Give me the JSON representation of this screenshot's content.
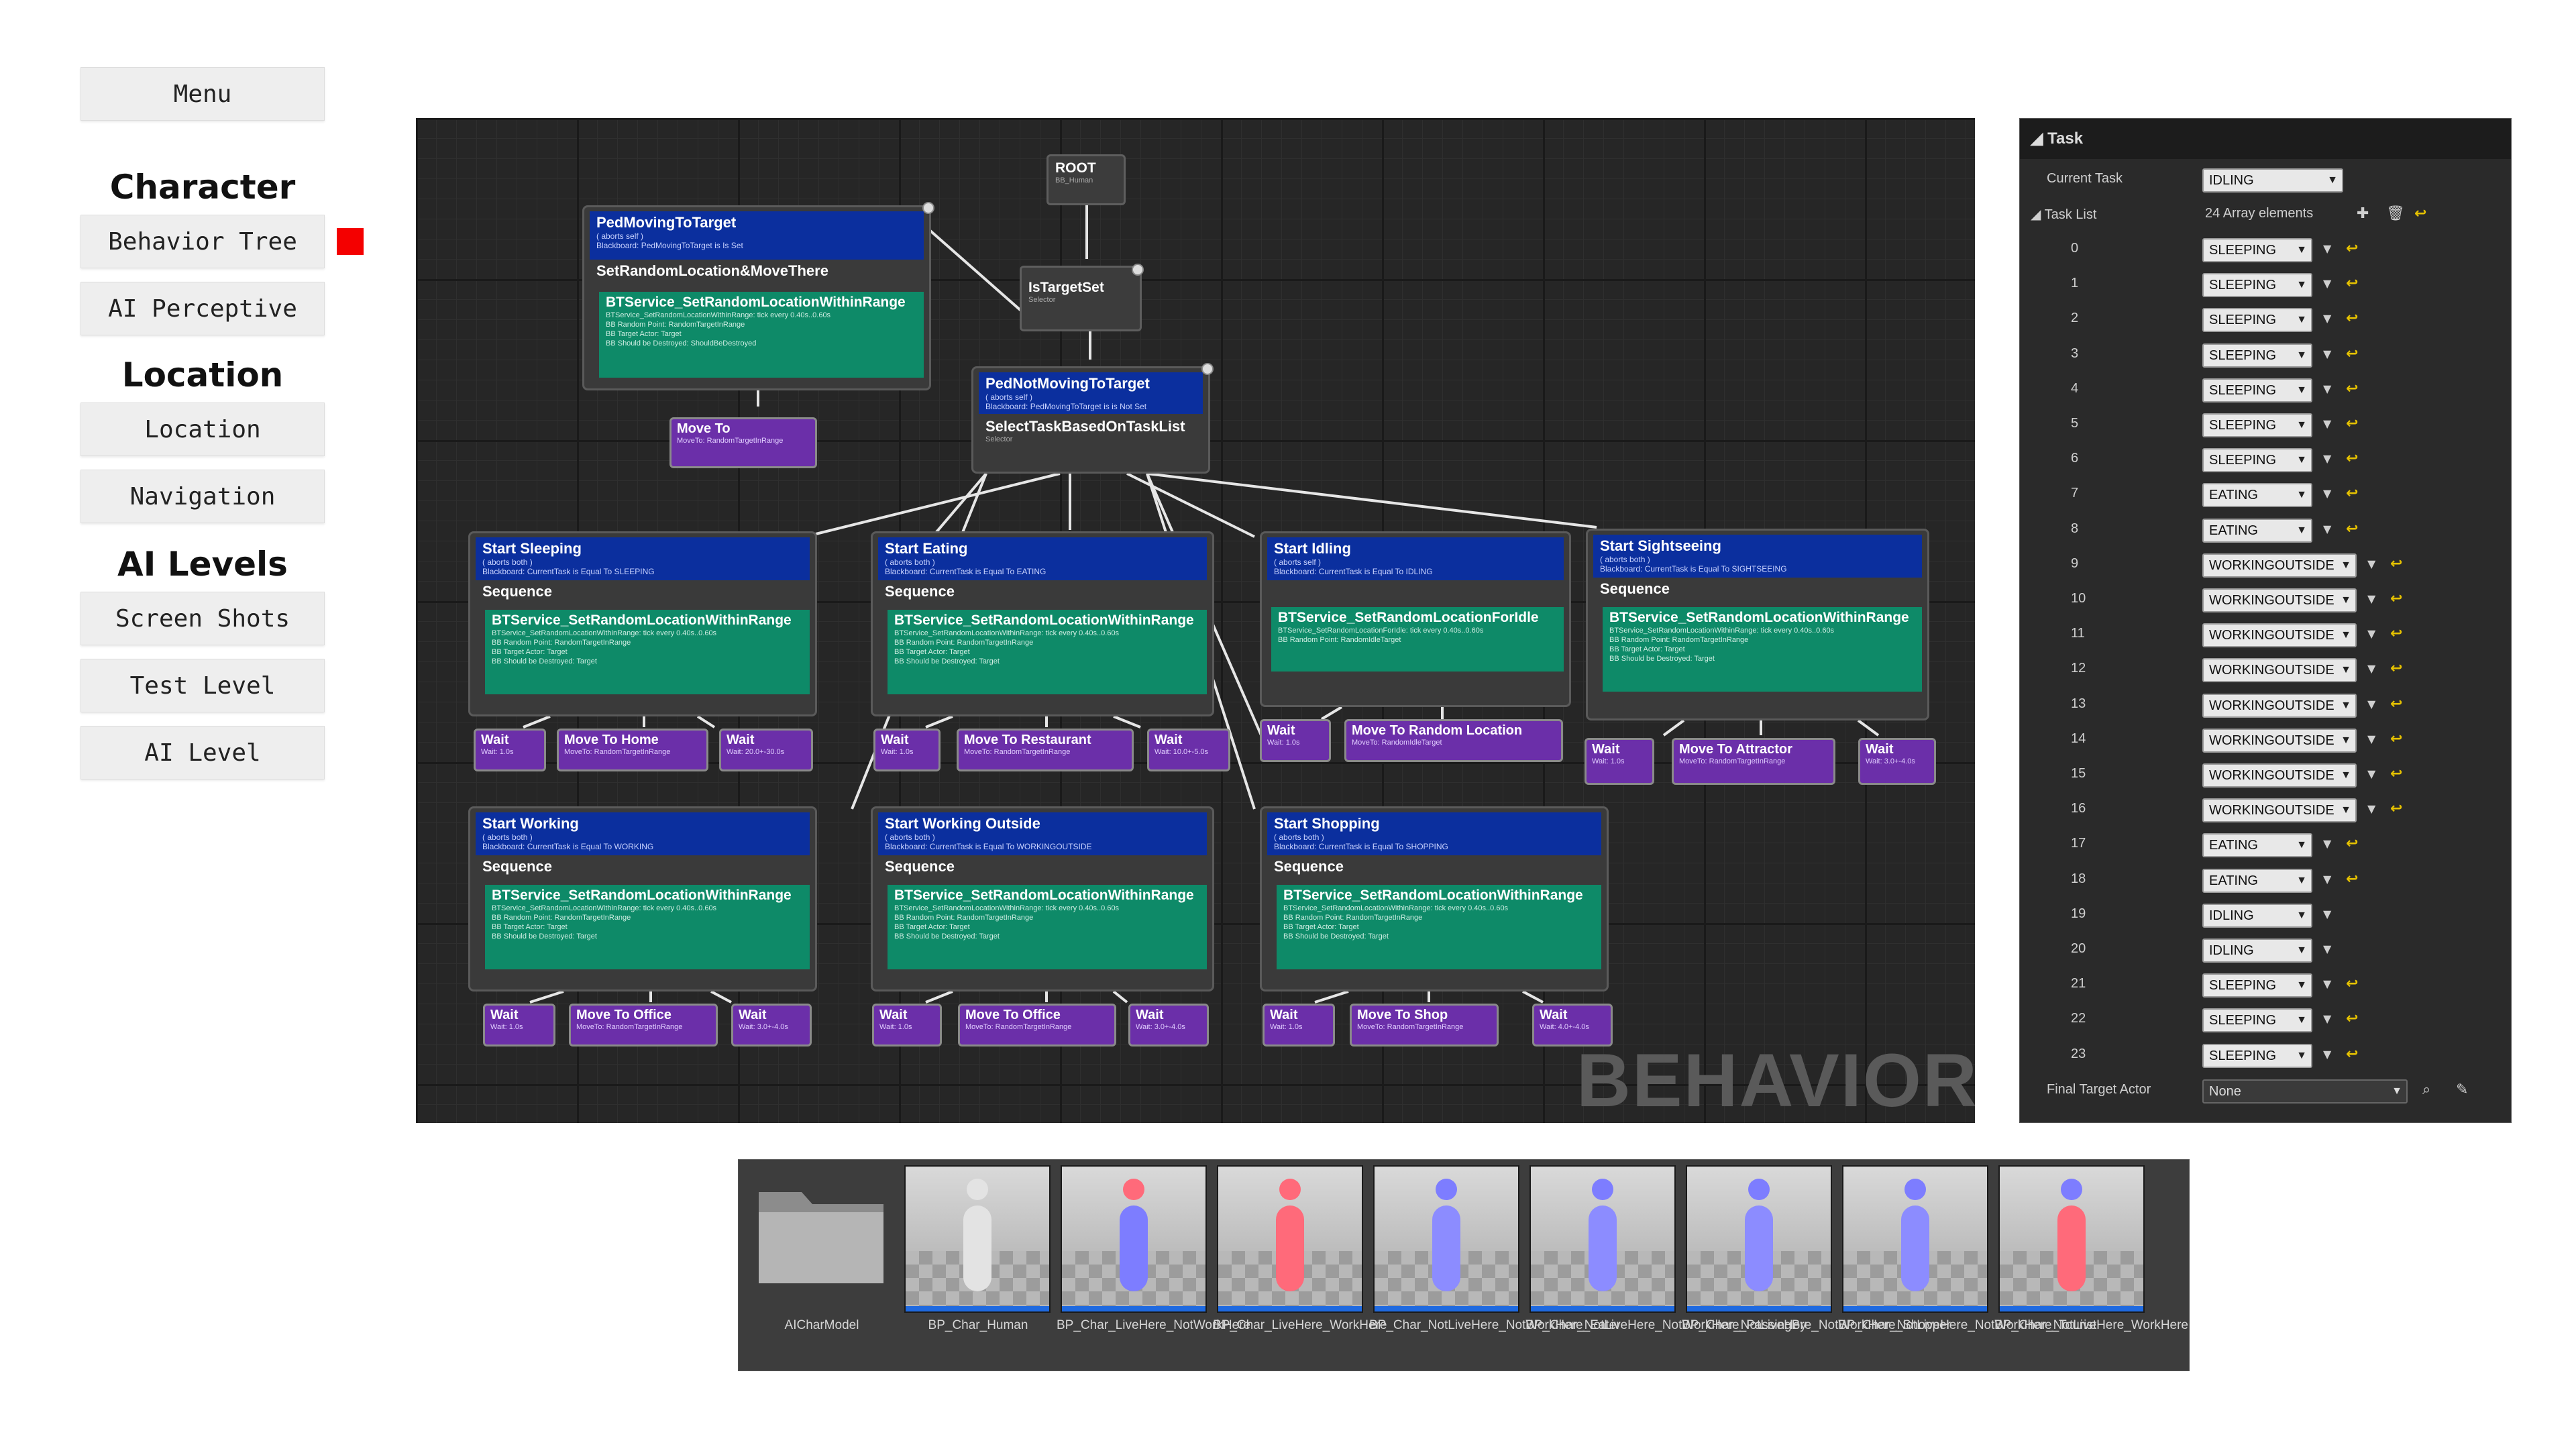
{
  "nav": {
    "menu": "Menu",
    "sections": [
      {
        "title": "Character",
        "items": [
          "Behavior Tree",
          "AI Perceptive"
        ]
      },
      {
        "title": "Location",
        "items": [
          "Location",
          "Navigation"
        ]
      },
      {
        "title": "AI Levels",
        "items": [
          "Screen Shots",
          "Test Level",
          "AI Level"
        ]
      }
    ],
    "marker_color": "#f40000"
  },
  "graph": {
    "watermark": "BEHAVIOR TR",
    "root": {
      "title": "ROOT",
      "sub": "BB_Human"
    },
    "is_target_set": {
      "title": "IsTargetSet",
      "sub": "Selector"
    },
    "ped_moving": {
      "title": "PedMovingToTarget",
      "sub1": "( aborts self )",
      "sub2": "Blackboard: PedMovingToTarget is Is Set",
      "seq": "SetRandomLocation&MoveThere",
      "seq_sub": "Sequence",
      "svc": "BTService_SetRandomLocationWithinRange",
      "svc_d": [
        "BTService_SetRandomLocationWithinRange: tick every 0.40s..0.60s",
        "",
        "BB Random Point: RandomTargetInRange",
        "BB Target Actor: Target",
        "BB Should be Destroyed: ShouldBeDestroyed"
      ]
    },
    "move_to_top": {
      "title": "Move To",
      "sub": "MoveTo: RandomTargetInRange"
    },
    "ped_not_moving": {
      "title": "PedNotMovingToTarget",
      "sub1": "( aborts self )",
      "sub2": "Blackboard: PedMovingToTarget is is Not Set",
      "task": "SelectTaskBasedOnTaskList",
      "task_sub": "Selector"
    },
    "groups": [
      {
        "title": "Start Sleeping",
        "abort": "( aborts both )",
        "cond": "Blackboard: CurrentTask is Equal To SLEEPING",
        "svc": "BTService_SetRandomLocationWithinRange",
        "svc_d": [
          "BTService_SetRandomLocationWithinRange: tick every 0.40s..0.60s",
          "",
          "BB Random Point: RandomTargetInRange",
          "BB Target Actor: Target",
          "BB Should be Destroyed: Target"
        ],
        "tasks": [
          {
            "t": "Wait",
            "d": "Wait: 1.0s"
          },
          {
            "t": "Move To Home",
            "d": "MoveTo: RandomTargetInRange"
          },
          {
            "t": "Wait",
            "d": "Wait: 20.0+-30.0s"
          }
        ]
      },
      {
        "title": "Start Eating",
        "abort": "( aborts both )",
        "cond": "Blackboard: CurrentTask is Equal To EATING",
        "svc": "BTService_SetRandomLocationWithinRange",
        "svc_d": [
          "BTService_SetRandomLocationWithinRange: tick every 0.40s..0.60s",
          "",
          "BB Random Point: RandomTargetInRange",
          "BB Target Actor: Target",
          "BB Should be Destroyed: Target"
        ],
        "tasks": [
          {
            "t": "Wait",
            "d": "Wait: 1.0s"
          },
          {
            "t": "Move To Restaurant",
            "d": "MoveTo: RandomTargetInRange"
          },
          {
            "t": "Wait",
            "d": "Wait: 10.0+-5.0s"
          }
        ]
      },
      {
        "title": "Start Idling",
        "abort": "( aborts self )",
        "cond": "Blackboard: CurrentTask is Equal To IDLING",
        "svc": "BTService_SetRandomLocationForIdle",
        "svc_d": [
          "BTService_SetRandomLocationForIdle: tick every 0.40s..0.60s",
          "",
          "BB Random Point: RandomIdleTarget"
        ],
        "tasks": [
          {
            "t": "Wait",
            "d": "Wait: 1.0s"
          },
          {
            "t": "Move To Random Location",
            "d": "MoveTo: RandomIdleTarget"
          }
        ]
      },
      {
        "title": "Start Sightseeing",
        "abort": "( aborts both )",
        "cond": "Blackboard: CurrentTask is Equal To SIGHTSEEING",
        "svc": "BTService_SetRandomLocationWithinRange",
        "svc_d": [
          "BTService_SetRandomLocationWithinRange: tick every 0.40s..0.60s",
          "",
          "BB Random Point: RandomTargetInRange",
          "BB Target Actor: Target",
          "BB Should be Destroyed: Target"
        ],
        "tasks": [
          {
            "t": "Wait",
            "d": "Wait: 1.0s"
          },
          {
            "t": "Move To Attractor",
            "d": "MoveTo: RandomTargetInRange"
          },
          {
            "t": "Wait",
            "d": "Wait: 3.0+-4.0s"
          }
        ]
      },
      {
        "title": "Start Working",
        "abort": "( aborts both )",
        "cond": "Blackboard: CurrentTask is Equal To WORKING",
        "svc": "BTService_SetRandomLocationWithinRange",
        "svc_d": [
          "BTService_SetRandomLocationWithinRange: tick every 0.40s..0.60s",
          "",
          "BB Random Point: RandomTargetInRange",
          "BB Target Actor: Target",
          "BB Should be Destroyed: Target"
        ],
        "tasks": [
          {
            "t": "Wait",
            "d": "Wait: 1.0s"
          },
          {
            "t": "Move To Office",
            "d": "MoveTo: RandomTargetInRange"
          },
          {
            "t": "Wait",
            "d": "Wait: 3.0+-4.0s"
          }
        ]
      },
      {
        "title": "Start Working Outside",
        "abort": "( aborts both )",
        "cond": "Blackboard: CurrentTask is Equal To WORKINGOUTSIDE",
        "svc": "BTService_SetRandomLocationWithinRange",
        "svc_d": [
          "BTService_SetRandomLocationWithinRange: tick every 0.40s..0.60s",
          "",
          "BB Random Point: RandomTargetInRange",
          "BB Target Actor: Target",
          "BB Should be Destroyed: Target"
        ],
        "tasks": [
          {
            "t": "Wait",
            "d": "Wait: 1.0s"
          },
          {
            "t": "Move To Office",
            "d": "MoveTo: RandomTargetInRange"
          },
          {
            "t": "Wait",
            "d": "Wait: 3.0+-4.0s"
          }
        ]
      },
      {
        "title": "Start Shopping",
        "abort": "( aborts both )",
        "cond": "Blackboard: CurrentTask is Equal To SHOPPING",
        "svc": "BTService_SetRandomLocationWithinRange",
        "svc_d": [
          "BTService_SetRandomLocationWithinRange: tick every 0.40s..0.60s",
          "",
          "BB Random Point: RandomTargetInRange",
          "BB Target Actor: Target",
          "BB Should be Destroyed: Target"
        ],
        "tasks": [
          {
            "t": "Wait",
            "d": "Wait: 1.0s"
          },
          {
            "t": "Move To Shop",
            "d": "MoveTo: RandomTargetInRange"
          },
          {
            "t": "Wait",
            "d": "Wait: 4.0+-4.0s"
          }
        ]
      }
    ]
  },
  "details": {
    "section": "Task",
    "current_task_label": "Current Task",
    "current_task_value": "IDLING",
    "task_list_label": "Task List",
    "task_list_count": "24 Array elements",
    "tasks": [
      "SLEEPING",
      "SLEEPING",
      "SLEEPING",
      "SLEEPING",
      "SLEEPING",
      "SLEEPING",
      "SLEEPING",
      "EATING",
      "EATING",
      "WORKINGOUTSIDE",
      "WORKINGOUTSIDE",
      "WORKINGOUTSIDE",
      "WORKINGOUTSIDE",
      "WORKINGOUTSIDE",
      "WORKINGOUTSIDE",
      "WORKINGOUTSIDE",
      "WORKINGOUTSIDE",
      "EATING",
      "EATING",
      "IDLING",
      "IDLING",
      "SLEEPING",
      "SLEEPING",
      "SLEEPING"
    ],
    "final_target_label": "Final Target Actor",
    "final_target_value": "None",
    "reset_color": "#e6c200"
  },
  "browser": {
    "assets": [
      {
        "name": "AICharModel",
        "kind": "folder"
      },
      {
        "name": "BP_Char_Human",
        "body": "#e3e3e3",
        "head": "#e3e3e3"
      },
      {
        "name": "BP_Char_LiveHere_NotWorkHere",
        "body": "#7d7dff",
        "head": "#ff6a7a"
      },
      {
        "name": "BP_Char_LiveHere_WorkHere",
        "body": "#ff6a7a",
        "head": "#ff6a7a"
      },
      {
        "name": "BP_Char_NotLiveHere_NotWorkHere_Eater",
        "body": "#8c8cff",
        "head": "#7d7dff"
      },
      {
        "name": "BP_Char_NotLiveHere_NotWorkHere_PassingBy",
        "body": "#8c8cff",
        "head": "#7d7dff"
      },
      {
        "name": "BP_Char_NotLiveHere_NotWorkHere_Shopper",
        "body": "#8c8cff",
        "head": "#7d7dff"
      },
      {
        "name": "BP_Char_NotLiveHere_NotWorkHere_Tourist",
        "body": "#8c8cff",
        "head": "#7d7dff"
      },
      {
        "name": "BP_Char_NotLiveHere_WorkHere",
        "body": "#ff6a7a",
        "head": "#7d7dff"
      }
    ]
  }
}
